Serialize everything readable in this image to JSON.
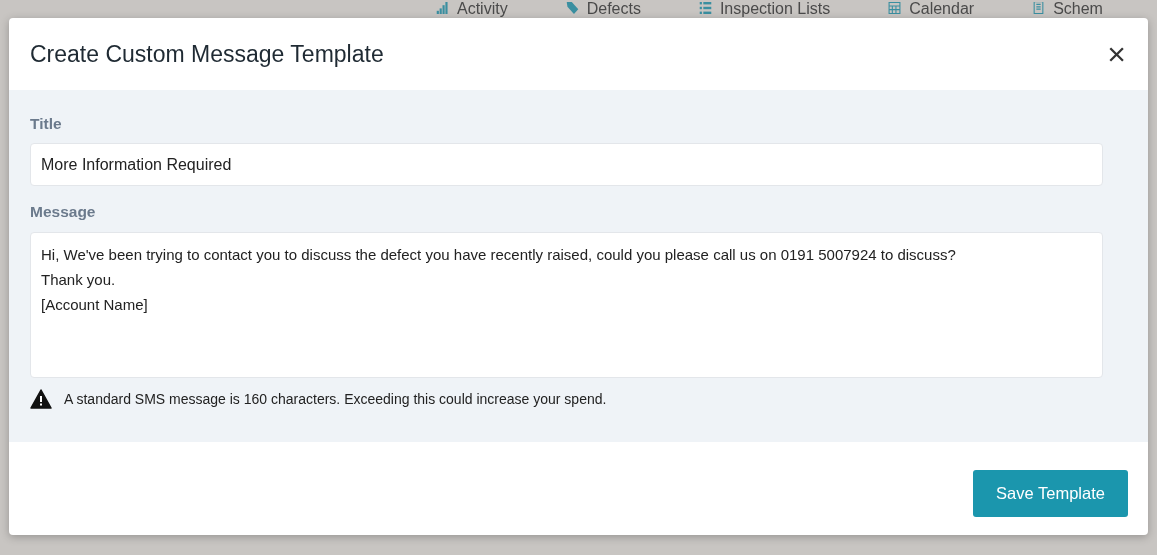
{
  "background_nav": [
    {
      "label": "Activity",
      "kind": "signal"
    },
    {
      "label": "Defects",
      "kind": "tag"
    },
    {
      "label": "Inspection Lists",
      "kind": "list"
    },
    {
      "label": "Calendar",
      "kind": "calendar"
    },
    {
      "label": "Schem",
      "kind": "doc"
    }
  ],
  "modal": {
    "title": "Create Custom Message Template",
    "close": "×",
    "fields": [
      {
        "label": "Title",
        "kind": "input",
        "value": "More Information Required"
      },
      {
        "label": "Message",
        "kind": "textarea",
        "value": "Hi, We've been trying to contact you to discuss the defect you have recently raised, could you please call us on 0191 5007924 to discuss?\nThank you.\n[Account Name]"
      }
    ],
    "warning": "A standard SMS message is 160 characters. Exceeding this could increase your spend.",
    "buttons": [
      "Save Template"
    ]
  }
}
